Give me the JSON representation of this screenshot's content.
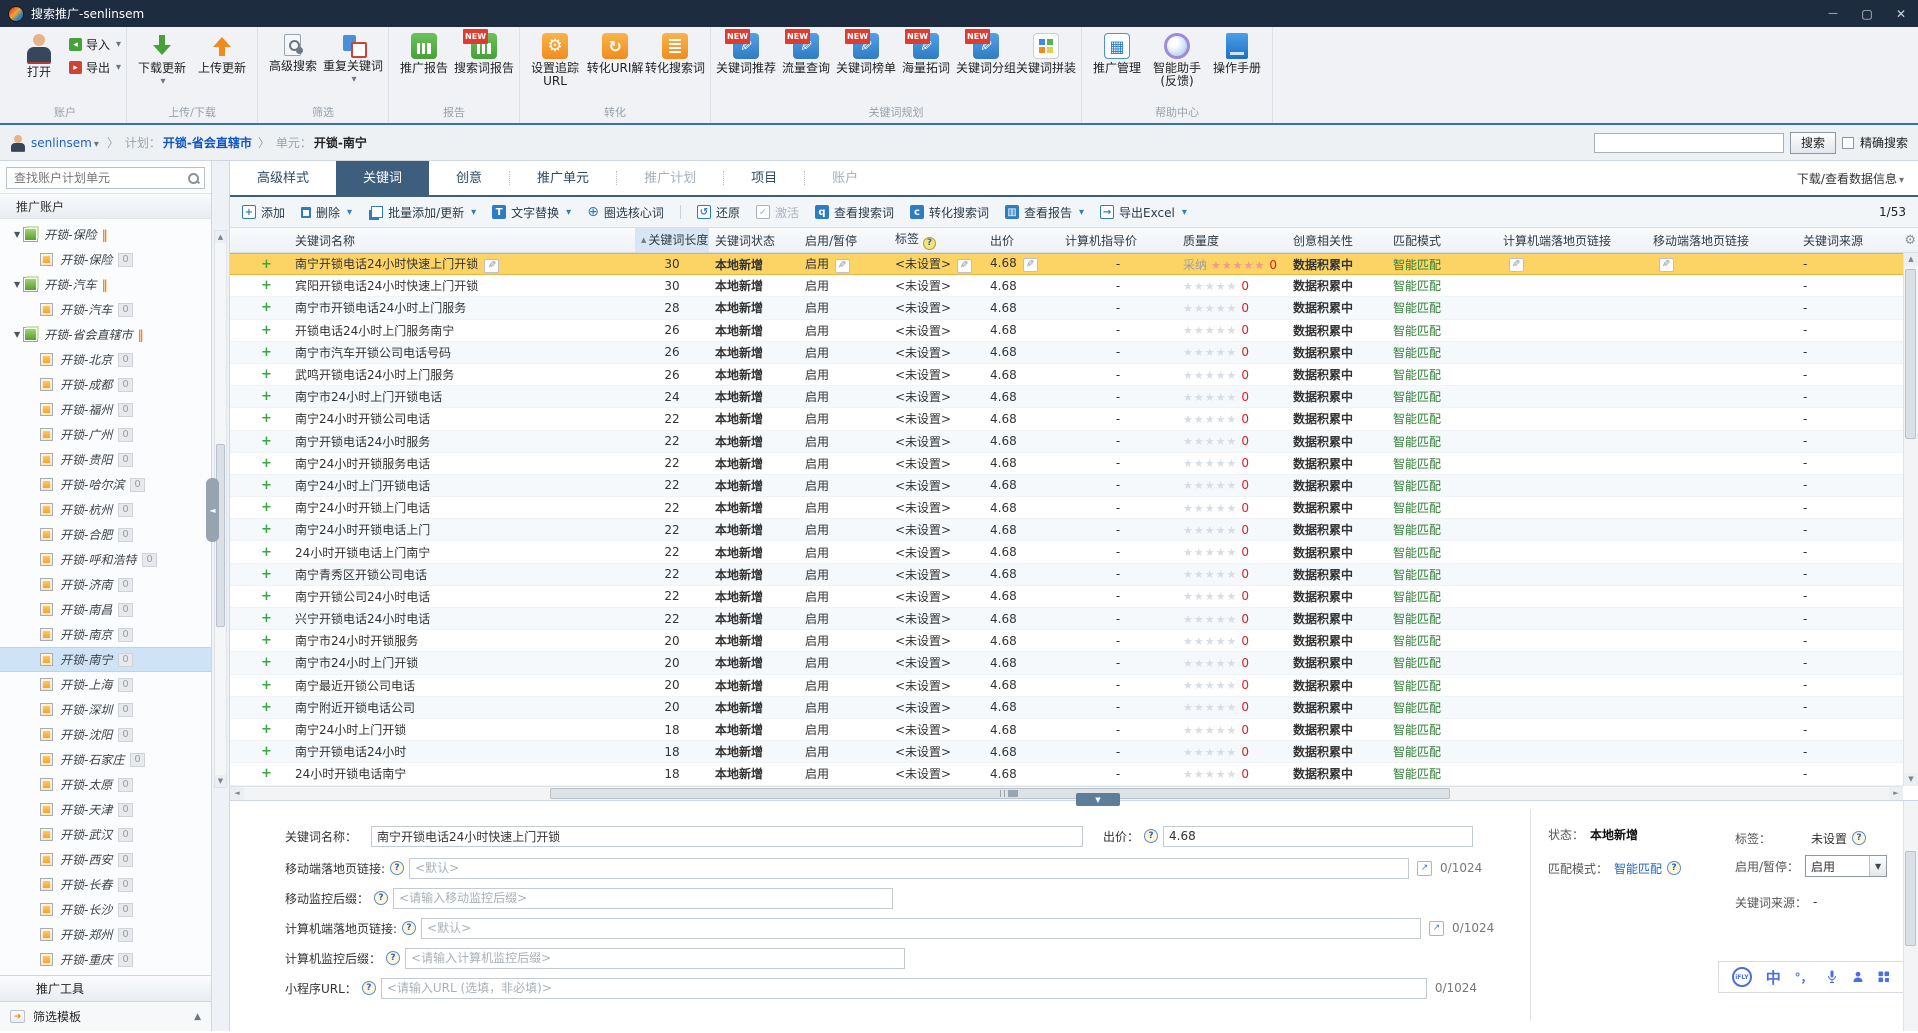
{
  "window": {
    "title": "搜索推广-senlinsem"
  },
  "ribbon": {
    "groups": [
      {
        "label": "账户",
        "buttons": [
          {
            "label": "打开"
          },
          {
            "label": "导入"
          },
          {
            "label": "导出"
          }
        ]
      },
      {
        "label": "上传/下载",
        "buttons": [
          {
            "label": "下载更新"
          },
          {
            "label": "上传更新"
          }
        ]
      },
      {
        "label": "筛选",
        "buttons": [
          {
            "label": "高级搜索"
          },
          {
            "label": "重复关键词"
          }
        ]
      },
      {
        "label": "报告",
        "buttons": [
          {
            "label": "推广报告"
          },
          {
            "label": "搜索词报告",
            "badge": "NEW"
          }
        ]
      },
      {
        "label": "转化",
        "buttons": [
          {
            "label": "设置追踪URL"
          },
          {
            "label": "转化URI解"
          },
          {
            "label": "转化搜索词"
          }
        ]
      },
      {
        "label": "关键词规划",
        "buttons": [
          {
            "label": "关键词推荐",
            "badge": "NEW"
          },
          {
            "label": "流量查询",
            "badge": "NEW"
          },
          {
            "label": "关键词榜单",
            "badge": "NEW"
          },
          {
            "label": "海量拓词",
            "badge": "NEW"
          },
          {
            "label": "关键词分组",
            "badge": "NEW"
          },
          {
            "label": "关键词拼装"
          }
        ]
      },
      {
        "label": "帮助中心",
        "buttons": [
          {
            "label": "推广管理"
          },
          {
            "label": "智能助手(反馈)"
          },
          {
            "label": "操作手册"
          }
        ]
      }
    ]
  },
  "breadcrumb": {
    "user": "senlinsem",
    "plan_label": "计划：",
    "plan": "开锁-省会直辖市",
    "unit_label": "单元：",
    "unit": "开锁-南宁",
    "search_button": "搜索",
    "exact_label": "精确搜索"
  },
  "sidebar": {
    "search_placeholder": "查找账户计划单元",
    "header": "推广账户",
    "tools_label": "推广工具",
    "filter_label": "筛选模板",
    "tree": [
      {
        "type": "campaign",
        "label": "开锁-保险",
        "paused": true
      },
      {
        "type": "unit",
        "label": "开锁-保险",
        "badge": "0"
      },
      {
        "type": "campaign",
        "label": "开锁-汽车",
        "paused": true
      },
      {
        "type": "unit",
        "label": "开锁-汽车",
        "badge": "0"
      },
      {
        "type": "campaign",
        "label": "开锁-省会直辖市",
        "paused": true
      },
      {
        "type": "unit",
        "label": "开锁-北京",
        "badge": "0"
      },
      {
        "type": "unit",
        "label": "开锁-成都",
        "badge": "0"
      },
      {
        "type": "unit",
        "label": "开锁-福州",
        "badge": "0"
      },
      {
        "type": "unit",
        "label": "开锁-广州",
        "badge": "0"
      },
      {
        "type": "unit",
        "label": "开锁-贵阳",
        "badge": "0"
      },
      {
        "type": "unit",
        "label": "开锁-哈尔滨",
        "badge": "0"
      },
      {
        "type": "unit",
        "label": "开锁-杭州",
        "badge": "0"
      },
      {
        "type": "unit",
        "label": "开锁-合肥",
        "badge": "0"
      },
      {
        "type": "unit",
        "label": "开锁-呼和浩特",
        "badge": "0"
      },
      {
        "type": "unit",
        "label": "开锁-济南",
        "badge": "0"
      },
      {
        "type": "unit",
        "label": "开锁-南昌",
        "badge": "0"
      },
      {
        "type": "unit",
        "label": "开锁-南京",
        "badge": "0"
      },
      {
        "type": "unit",
        "label": "开锁-南宁",
        "badge": "0",
        "selected": true
      },
      {
        "type": "unit",
        "label": "开锁-上海",
        "badge": "0"
      },
      {
        "type": "unit",
        "label": "开锁-深圳",
        "badge": "0"
      },
      {
        "type": "unit",
        "label": "开锁-沈阳",
        "badge": "0"
      },
      {
        "type": "unit",
        "label": "开锁-石家庄",
        "badge": "0"
      },
      {
        "type": "unit",
        "label": "开锁-太原",
        "badge": "0"
      },
      {
        "type": "unit",
        "label": "开锁-天津",
        "badge": "0"
      },
      {
        "type": "unit",
        "label": "开锁-武汉",
        "badge": "0"
      },
      {
        "type": "unit",
        "label": "开锁-西安",
        "badge": "0"
      },
      {
        "type": "unit",
        "label": "开锁-长春",
        "badge": "0"
      },
      {
        "type": "unit",
        "label": "开锁-长沙",
        "badge": "0"
      },
      {
        "type": "unit",
        "label": "开锁-郑州",
        "badge": "0"
      },
      {
        "type": "unit",
        "label": "开锁-重庆",
        "badge": "0"
      }
    ]
  },
  "tabs": {
    "items": [
      "高级样式",
      "关键词",
      "创意",
      "推广单元",
      "推广计划",
      "项目",
      "账户"
    ],
    "data_info": "下载/查看数据信息"
  },
  "actions": {
    "add": "添加",
    "del": "删除",
    "batch": "批量添加/更新",
    "replace": "文字替换",
    "core": "圈选核心词",
    "restore": "还原",
    "activate": "激活",
    "view_search": "查看搜索词",
    "conv_search": "转化搜索词",
    "view_report": "查看报告",
    "export_excel": "导出Excel",
    "page": "1/53"
  },
  "table": {
    "columns": [
      "关键词名称",
      "关键词长度",
      "关键词状态",
      "启用/暂停",
      "标签",
      "出价",
      "计算机指导价",
      "质量度",
      "创意相关性",
      "匹配模式",
      "计算机端落地页链接",
      "移动端落地页链接",
      "关键词来源"
    ],
    "rows": [
      {
        "name": "南宁开锁电话24小时快速上门开锁",
        "len": "30",
        "status": "本地新增",
        "onoff": "启用",
        "tag": "<未设置>",
        "bid": "4.68",
        "guide": "-",
        "adopt": "采纳",
        "q": "0",
        "creative": "数据积累中",
        "match": "智能匹配",
        "source": "-",
        "selected": true
      },
      {
        "name": "宾阳开锁电话24小时快速上门开锁",
        "len": "30",
        "status": "本地新增",
        "onoff": "启用",
        "tag": "<未设置>",
        "bid": "4.68",
        "guide": "-",
        "q": "0",
        "creative": "数据积累中",
        "match": "智能匹配",
        "source": "-"
      },
      {
        "name": "南宁市开锁电话24小时上门服务",
        "len": "28",
        "status": "本地新增",
        "onoff": "启用",
        "tag": "<未设置>",
        "bid": "4.68",
        "guide": "-",
        "q": "0",
        "creative": "数据积累中",
        "match": "智能匹配",
        "source": "-"
      },
      {
        "name": "开锁电话24小时上门服务南宁",
        "len": "26",
        "status": "本地新增",
        "onoff": "启用",
        "tag": "<未设置>",
        "bid": "4.68",
        "guide": "-",
        "q": "0",
        "creative": "数据积累中",
        "match": "智能匹配",
        "source": "-"
      },
      {
        "name": "南宁市汽车开锁公司电话号码",
        "len": "26",
        "status": "本地新增",
        "onoff": "启用",
        "tag": "<未设置>",
        "bid": "4.68",
        "guide": "-",
        "q": "0",
        "creative": "数据积累中",
        "match": "智能匹配",
        "source": "-"
      },
      {
        "name": "武鸣开锁电话24小时上门服务",
        "len": "26",
        "status": "本地新增",
        "onoff": "启用",
        "tag": "<未设置>",
        "bid": "4.68",
        "guide": "-",
        "q": "0",
        "creative": "数据积累中",
        "match": "智能匹配",
        "source": "-"
      },
      {
        "name": "南宁市24小时上门开锁电话",
        "len": "24",
        "status": "本地新增",
        "onoff": "启用",
        "tag": "<未设置>",
        "bid": "4.68",
        "guide": "-",
        "q": "0",
        "creative": "数据积累中",
        "match": "智能匹配",
        "source": "-"
      },
      {
        "name": "南宁24小时开锁公司电话",
        "len": "22",
        "status": "本地新增",
        "onoff": "启用",
        "tag": "<未设置>",
        "bid": "4.68",
        "guide": "-",
        "q": "0",
        "creative": "数据积累中",
        "match": "智能匹配",
        "source": "-"
      },
      {
        "name": "南宁开锁电话24小时服务",
        "len": "22",
        "status": "本地新增",
        "onoff": "启用",
        "tag": "<未设置>",
        "bid": "4.68",
        "guide": "-",
        "q": "0",
        "creative": "数据积累中",
        "match": "智能匹配",
        "source": "-"
      },
      {
        "name": "南宁24小时开锁服务电话",
        "len": "22",
        "status": "本地新增",
        "onoff": "启用",
        "tag": "<未设置>",
        "bid": "4.68",
        "guide": "-",
        "q": "0",
        "creative": "数据积累中",
        "match": "智能匹配",
        "source": "-"
      },
      {
        "name": "南宁24小时上门开锁电话",
        "len": "22",
        "status": "本地新增",
        "onoff": "启用",
        "tag": "<未设置>",
        "bid": "4.68",
        "guide": "-",
        "q": "0",
        "creative": "数据积累中",
        "match": "智能匹配",
        "source": "-"
      },
      {
        "name": "南宁24小时开锁上门电话",
        "len": "22",
        "status": "本地新增",
        "onoff": "启用",
        "tag": "<未设置>",
        "bid": "4.68",
        "guide": "-",
        "q": "0",
        "creative": "数据积累中",
        "match": "智能匹配",
        "source": "-"
      },
      {
        "name": "南宁24小时开锁电话上门",
        "len": "22",
        "status": "本地新增",
        "onoff": "启用",
        "tag": "<未设置>",
        "bid": "4.68",
        "guide": "-",
        "q": "0",
        "creative": "数据积累中",
        "match": "智能匹配",
        "source": "-"
      },
      {
        "name": "24小时开锁电话上门南宁",
        "len": "22",
        "status": "本地新增",
        "onoff": "启用",
        "tag": "<未设置>",
        "bid": "4.68",
        "guide": "-",
        "q": "0",
        "creative": "数据积累中",
        "match": "智能匹配",
        "source": "-"
      },
      {
        "name": "南宁青秀区开锁公司电话",
        "len": "22",
        "status": "本地新增",
        "onoff": "启用",
        "tag": "<未设置>",
        "bid": "4.68",
        "guide": "-",
        "q": "0",
        "creative": "数据积累中",
        "match": "智能匹配",
        "source": "-"
      },
      {
        "name": "南宁开锁公司24小时电话",
        "len": "22",
        "status": "本地新增",
        "onoff": "启用",
        "tag": "<未设置>",
        "bid": "4.68",
        "guide": "-",
        "q": "0",
        "creative": "数据积累中",
        "match": "智能匹配",
        "source": "-"
      },
      {
        "name": "兴宁开锁电话24小时电话",
        "len": "22",
        "status": "本地新增",
        "onoff": "启用",
        "tag": "<未设置>",
        "bid": "4.68",
        "guide": "-",
        "q": "0",
        "creative": "数据积累中",
        "match": "智能匹配",
        "source": "-"
      },
      {
        "name": "南宁市24小时开锁服务",
        "len": "20",
        "status": "本地新增",
        "onoff": "启用",
        "tag": "<未设置>",
        "bid": "4.68",
        "guide": "-",
        "q": "0",
        "creative": "数据积累中",
        "match": "智能匹配",
        "source": "-"
      },
      {
        "name": "南宁市24小时上门开锁",
        "len": "20",
        "status": "本地新增",
        "onoff": "启用",
        "tag": "<未设置>",
        "bid": "4.68",
        "guide": "-",
        "q": "0",
        "creative": "数据积累中",
        "match": "智能匹配",
        "source": "-"
      },
      {
        "name": "南宁最近开锁公司电话",
        "len": "20",
        "status": "本地新增",
        "onoff": "启用",
        "tag": "<未设置>",
        "bid": "4.68",
        "guide": "-",
        "q": "0",
        "creative": "数据积累中",
        "match": "智能匹配",
        "source": "-"
      },
      {
        "name": "南宁附近开锁电话公司",
        "len": "20",
        "status": "本地新增",
        "onoff": "启用",
        "tag": "<未设置>",
        "bid": "4.68",
        "guide": "-",
        "q": "0",
        "creative": "数据积累中",
        "match": "智能匹配",
        "source": "-"
      },
      {
        "name": "南宁24小时上门开锁",
        "len": "18",
        "status": "本地新增",
        "onoff": "启用",
        "tag": "<未设置>",
        "bid": "4.68",
        "guide": "-",
        "q": "0",
        "creative": "数据积累中",
        "match": "智能匹配",
        "source": "-"
      },
      {
        "name": "南宁开锁电话24小时",
        "len": "18",
        "status": "本地新增",
        "onoff": "启用",
        "tag": "<未设置>",
        "bid": "4.68",
        "guide": "-",
        "q": "0",
        "creative": "数据积累中",
        "match": "智能匹配",
        "source": "-"
      },
      {
        "name": "24小时开锁电话南宁",
        "len": "18",
        "status": "本地新增",
        "onoff": "启用",
        "tag": "<未设置>",
        "bid": "4.68",
        "guide": "-",
        "q": "0",
        "creative": "数据积累中",
        "match": "智能匹配",
        "source": "-"
      }
    ]
  },
  "detail": {
    "kwname": {
      "label": "关键词名称：",
      "value": "南宁开锁电话24小时快速上门开锁"
    },
    "bid": {
      "label": "出价：",
      "value": "4.68"
    },
    "moblink": {
      "label": "移动端落地页链接:",
      "placeholder": "<默认>",
      "counter": "0/1024"
    },
    "mobsuffix": {
      "label": "移动监控后缀：",
      "placeholder": "<请输入移动监控后缀>"
    },
    "pclink": {
      "label": "计算机端落地页链接:",
      "placeholder": "<默认>",
      "counter": "0/1024"
    },
    "pcsuffix": {
      "label": "计算机监控后缀：",
      "placeholder": "<请输入计算机监控后缀>"
    },
    "miniurl": {
      "label": "小程序URL：",
      "placeholder": "<请输入URL (选填，非必填)>",
      "counter": "0/1024"
    },
    "status_label": "状态：",
    "status": "本地新增",
    "match_label": "匹配模式：",
    "match": "智能匹配",
    "tag_label": "标签：",
    "tag": "未设置",
    "onoff_label": "启用/暂停：",
    "onoff": "启用",
    "source_label": "关键词来源：",
    "source": "-"
  }
}
